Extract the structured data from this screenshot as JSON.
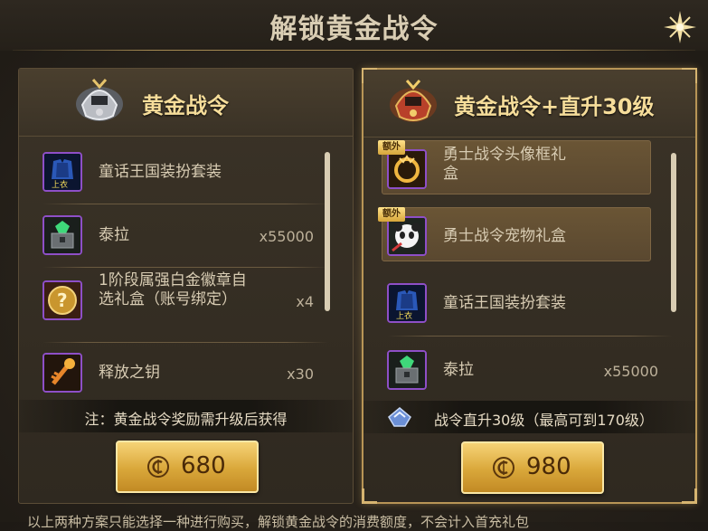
{
  "title": "解锁黄金战令",
  "left_panel": {
    "title": "黄金战令",
    "items": [
      {
        "name": "童话王国装扮套装",
        "qty": "",
        "icon": "armor-icon",
        "icon_tag": "上衣"
      },
      {
        "name": "泰拉",
        "qty": "x55000",
        "icon": "terra-chest-icon"
      },
      {
        "name": "1阶段属强白金徽章自选礼盒（账号绑定）",
        "qty": "x4",
        "icon": "question-box-icon"
      },
      {
        "name": "释放之钥",
        "qty": "x30",
        "icon": "key-icon"
      }
    ],
    "note": "注：黄金战令奖励需升级后获得",
    "price": "680"
  },
  "right_panel": {
    "title": "黄金战令+直升30级",
    "items": [
      {
        "name": "勇士战令头像框礼盒",
        "badge": "额外",
        "icon": "avatar-frame-icon"
      },
      {
        "name": "勇士战令宠物礼盒",
        "badge": "额外",
        "icon": "panda-pet-icon"
      },
      {
        "name": "童话王国装扮套装",
        "qty": "",
        "icon": "armor-icon",
        "icon_tag": "上衣"
      },
      {
        "name": "泰拉",
        "qty": "x55000",
        "icon": "terra-chest-icon"
      }
    ],
    "note": "战令直升30级（最高可到170级）",
    "price": "980"
  },
  "footer": "以上两种方案只能选择一种进行购买，解锁黄金战令的消费额度，不会计入首充礼包",
  "colors": {
    "accent_gold": "#f6dd9a",
    "button_gold": "#d9a73a",
    "rare_purple": "#8e4fc7"
  }
}
